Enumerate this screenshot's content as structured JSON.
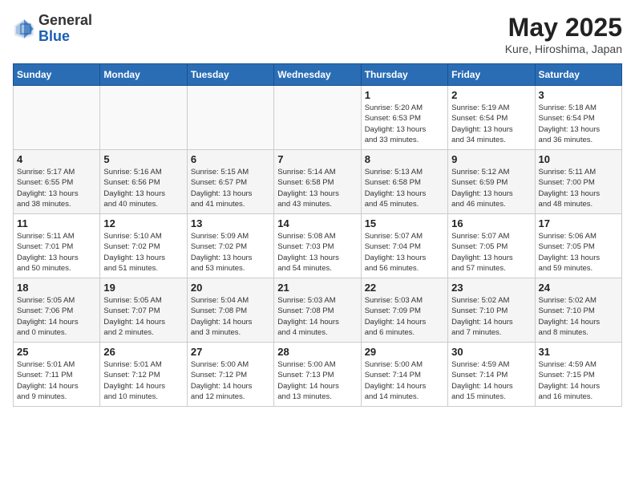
{
  "header": {
    "logo_general": "General",
    "logo_blue": "Blue",
    "month_year": "May 2025",
    "location": "Kure, Hiroshima, Japan"
  },
  "weekdays": [
    "Sunday",
    "Monday",
    "Tuesday",
    "Wednesday",
    "Thursday",
    "Friday",
    "Saturday"
  ],
  "weeks": [
    [
      {
        "day": "",
        "info": ""
      },
      {
        "day": "",
        "info": ""
      },
      {
        "day": "",
        "info": ""
      },
      {
        "day": "",
        "info": ""
      },
      {
        "day": "1",
        "info": "Sunrise: 5:20 AM\nSunset: 6:53 PM\nDaylight: 13 hours\nand 33 minutes."
      },
      {
        "day": "2",
        "info": "Sunrise: 5:19 AM\nSunset: 6:54 PM\nDaylight: 13 hours\nand 34 minutes."
      },
      {
        "day": "3",
        "info": "Sunrise: 5:18 AM\nSunset: 6:54 PM\nDaylight: 13 hours\nand 36 minutes."
      }
    ],
    [
      {
        "day": "4",
        "info": "Sunrise: 5:17 AM\nSunset: 6:55 PM\nDaylight: 13 hours\nand 38 minutes."
      },
      {
        "day": "5",
        "info": "Sunrise: 5:16 AM\nSunset: 6:56 PM\nDaylight: 13 hours\nand 40 minutes."
      },
      {
        "day": "6",
        "info": "Sunrise: 5:15 AM\nSunset: 6:57 PM\nDaylight: 13 hours\nand 41 minutes."
      },
      {
        "day": "7",
        "info": "Sunrise: 5:14 AM\nSunset: 6:58 PM\nDaylight: 13 hours\nand 43 minutes."
      },
      {
        "day": "8",
        "info": "Sunrise: 5:13 AM\nSunset: 6:58 PM\nDaylight: 13 hours\nand 45 minutes."
      },
      {
        "day": "9",
        "info": "Sunrise: 5:12 AM\nSunset: 6:59 PM\nDaylight: 13 hours\nand 46 minutes."
      },
      {
        "day": "10",
        "info": "Sunrise: 5:11 AM\nSunset: 7:00 PM\nDaylight: 13 hours\nand 48 minutes."
      }
    ],
    [
      {
        "day": "11",
        "info": "Sunrise: 5:11 AM\nSunset: 7:01 PM\nDaylight: 13 hours\nand 50 minutes."
      },
      {
        "day": "12",
        "info": "Sunrise: 5:10 AM\nSunset: 7:02 PM\nDaylight: 13 hours\nand 51 minutes."
      },
      {
        "day": "13",
        "info": "Sunrise: 5:09 AM\nSunset: 7:02 PM\nDaylight: 13 hours\nand 53 minutes."
      },
      {
        "day": "14",
        "info": "Sunrise: 5:08 AM\nSunset: 7:03 PM\nDaylight: 13 hours\nand 54 minutes."
      },
      {
        "day": "15",
        "info": "Sunrise: 5:07 AM\nSunset: 7:04 PM\nDaylight: 13 hours\nand 56 minutes."
      },
      {
        "day": "16",
        "info": "Sunrise: 5:07 AM\nSunset: 7:05 PM\nDaylight: 13 hours\nand 57 minutes."
      },
      {
        "day": "17",
        "info": "Sunrise: 5:06 AM\nSunset: 7:05 PM\nDaylight: 13 hours\nand 59 minutes."
      }
    ],
    [
      {
        "day": "18",
        "info": "Sunrise: 5:05 AM\nSunset: 7:06 PM\nDaylight: 14 hours\nand 0 minutes."
      },
      {
        "day": "19",
        "info": "Sunrise: 5:05 AM\nSunset: 7:07 PM\nDaylight: 14 hours\nand 2 minutes."
      },
      {
        "day": "20",
        "info": "Sunrise: 5:04 AM\nSunset: 7:08 PM\nDaylight: 14 hours\nand 3 minutes."
      },
      {
        "day": "21",
        "info": "Sunrise: 5:03 AM\nSunset: 7:08 PM\nDaylight: 14 hours\nand 4 minutes."
      },
      {
        "day": "22",
        "info": "Sunrise: 5:03 AM\nSunset: 7:09 PM\nDaylight: 14 hours\nand 6 minutes."
      },
      {
        "day": "23",
        "info": "Sunrise: 5:02 AM\nSunset: 7:10 PM\nDaylight: 14 hours\nand 7 minutes."
      },
      {
        "day": "24",
        "info": "Sunrise: 5:02 AM\nSunset: 7:10 PM\nDaylight: 14 hours\nand 8 minutes."
      }
    ],
    [
      {
        "day": "25",
        "info": "Sunrise: 5:01 AM\nSunset: 7:11 PM\nDaylight: 14 hours\nand 9 minutes."
      },
      {
        "day": "26",
        "info": "Sunrise: 5:01 AM\nSunset: 7:12 PM\nDaylight: 14 hours\nand 10 minutes."
      },
      {
        "day": "27",
        "info": "Sunrise: 5:00 AM\nSunset: 7:12 PM\nDaylight: 14 hours\nand 12 minutes."
      },
      {
        "day": "28",
        "info": "Sunrise: 5:00 AM\nSunset: 7:13 PM\nDaylight: 14 hours\nand 13 minutes."
      },
      {
        "day": "29",
        "info": "Sunrise: 5:00 AM\nSunset: 7:14 PM\nDaylight: 14 hours\nand 14 minutes."
      },
      {
        "day": "30",
        "info": "Sunrise: 4:59 AM\nSunset: 7:14 PM\nDaylight: 14 hours\nand 15 minutes."
      },
      {
        "day": "31",
        "info": "Sunrise: 4:59 AM\nSunset: 7:15 PM\nDaylight: 14 hours\nand 16 minutes."
      }
    ]
  ]
}
